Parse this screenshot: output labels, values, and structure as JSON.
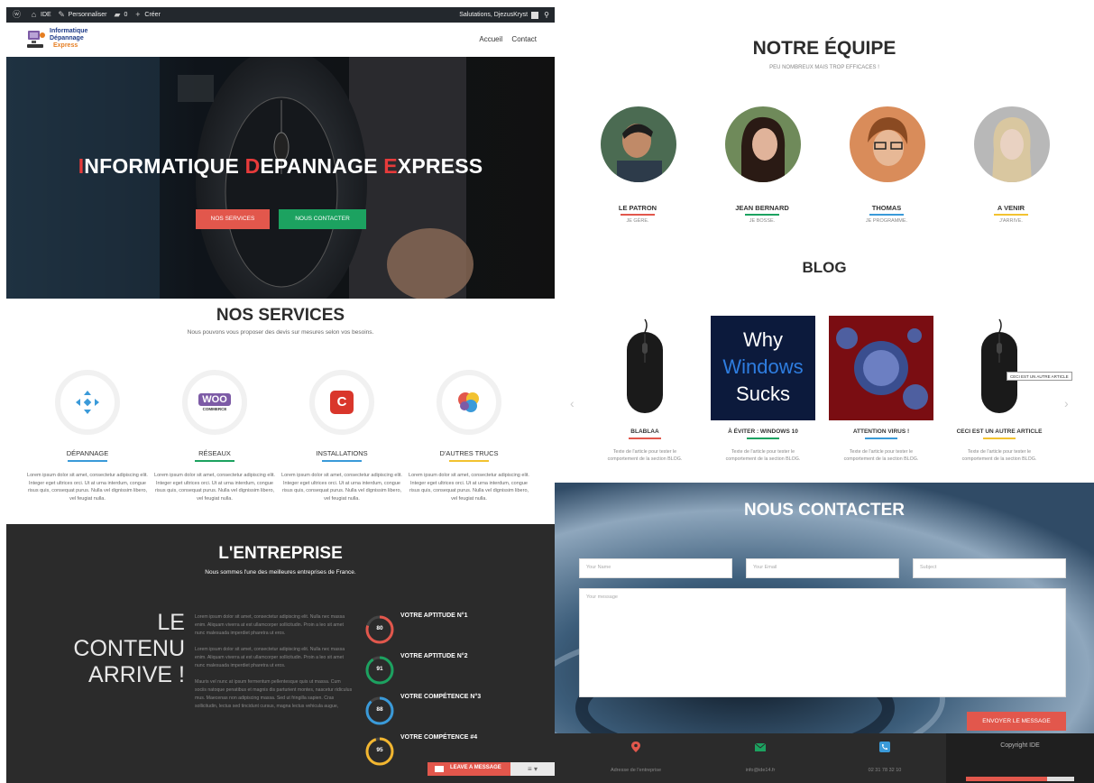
{
  "admin_bar": {
    "site_name": "IDE",
    "customize": "Personnaliser",
    "comments_count": "0",
    "new_label": "Créer",
    "greeting": "Salutations, DjezusKryst"
  },
  "site": {
    "logo_line1": "Informatique",
    "logo_line2": "Dépannage",
    "logo_line3": "Express",
    "nav": [
      "Accueil",
      "Contact"
    ]
  },
  "hero": {
    "title_parts": [
      {
        "letter": "I",
        "rest": "NFORMATIQUE "
      },
      {
        "letter": "D",
        "rest": "EPANNAGE "
      },
      {
        "letter": "E",
        "rest": "XPRESS"
      }
    ],
    "btn_services": "NOS SERVICES",
    "btn_contact": "NOUS CONTACTER"
  },
  "services": {
    "title": "NOS SERVICES",
    "subtitle": "Nous pouvons vous proposer des devis sur mesures selon vos besoins.",
    "items": [
      {
        "title": "DÉPANNAGE",
        "color": "#3a9ad9",
        "text": "Lorem ipsum dolor sit amet, consectetur adipiscing elit. Integer eget ultrices orci. Ut at urna interdum, congue risus quis, consequat purus. Nulla vel dignissim libero, vel feugiat nulla."
      },
      {
        "title": "RÉSEAUX",
        "color": "#1ca260",
        "text": "Lorem ipsum dolor sit amet, consectetur adipiscing elit. Integer eget ultrices orci. Ut at urna interdum, congue risus quis, consequat purus. Nulla vel dignissim libero, vel feugiat nulla."
      },
      {
        "title": "INSTALLATIONS",
        "color": "#3a9ad9",
        "text": "Lorem ipsum dolor sit amet, consectetur adipiscing elit. Integer eget ultrices orci. Ut at urna interdum, congue risus quis, consequat purus. Nulla vel dignissim libero, vel feugiat nulla."
      },
      {
        "title": "D'AUTRES TRUCS",
        "color": "#f2c230",
        "text": "Lorem ipsum dolor sit amet, consectetur adipiscing elit. Integer eget ultrices orci. Ut at urna interdum, congue risus quis, consequat purus. Nulla vel dignissim libero, vel feugiat nulla."
      }
    ],
    "woo_label": "WOO",
    "woo_sub": "COMMERCE",
    "c_label": "C"
  },
  "entreprise": {
    "title": "L'ENTREPRISE",
    "subtitle": "Nous sommes l'une des meilleures entreprises de France.",
    "big_line1": "LE",
    "big_line2": "CONTENU",
    "big_line3": "ARRIVE !",
    "paragraphs": [
      "Lorem ipsum dolor sit amet, consectetur adipiscing elit. Nulla nec massa enim. Aliquam viverra at est ullamcorper sollicitudin. Proin a leo sit amet nunc malesuada imperdiet pharetra ut eros.",
      "Lorem ipsum dolor sit amet, consectetur adipiscing elit. Nulla nec massa enim. Aliquam viverra at est ullamcorper sollicitudin. Proin a leo sit amet nunc malesuada imperdiet pharetra ut eros.",
      "Mauris vel nunc at ipsum fermentum pellentesque quis ut massa. Cum sociis natoque penatibus et magnis dis parturient montes, nascetur ridiculus mus. Maecenas non adipiscing massa. Sed ut fringilla sapien. Cras sollicitudin, lectus sed tincidunt cursus, magna lectus vehicula augue,"
    ],
    "skills": [
      {
        "name": "VOTRE APTITUDE N°1",
        "value": 80,
        "color": "#e2574c"
      },
      {
        "name": "VOTRE APTITUDE N°2",
        "value": 91,
        "color": "#1ca260"
      },
      {
        "name": "VOTRE COMPÉTENCE N°3",
        "value": 88,
        "color": "#3a9ad9"
      },
      {
        "name": "VOTRE COMPÉTENCE #4",
        "value": 95,
        "color": "#f2b630"
      }
    ]
  },
  "chat_widget": {
    "label": "LEAVE A MESSAGE"
  },
  "team": {
    "title": "NOTRE ÉQUIPE",
    "subtitle": "PEU NOMBREUX MAIS TROP EFFICACES !",
    "members": [
      {
        "name": "LE PATRON",
        "role": "JE GÈRE.",
        "color": "#e2574c"
      },
      {
        "name": "JEAN BERNARD",
        "role": "JE BOSSE.",
        "color": "#1ca260"
      },
      {
        "name": "THOMAS",
        "role": "JE PROGRAMME.",
        "color": "#3a9ad9"
      },
      {
        "name": "A VENIR",
        "role": "J'ARRIVE.",
        "color": "#f2c230"
      }
    ]
  },
  "blog": {
    "title": "BLOG",
    "windows_line1": "Why",
    "windows_line2": "Windows",
    "windows_line3": "Sucks",
    "tooltip": "CECI EST UN AUTRE ARTICLE",
    "posts": [
      {
        "title": "BLABLAA",
        "text": "Texte de l'article pour tester le comportement de la section BLOG.",
        "color": "#e2574c"
      },
      {
        "title": "À ÉVITER : WINDOWS 10",
        "text": "Texte de l'article pour tester le comportement de la section BLOG.",
        "color": "#1ca260"
      },
      {
        "title": "ATTENTION VIRUS !",
        "text": "Texte de l'article pour tester le comportement de la section BLOG.",
        "color": "#3a9ad9"
      },
      {
        "title": "CECI EST UN AUTRE ARTICLE",
        "text": "Texte de l'article pour tester le comportement de la section BLOG.",
        "color": "#f2c230"
      }
    ]
  },
  "contact": {
    "title": "NOUS CONTACTER",
    "name_placeholder": "Your Name",
    "email_placeholder": "Your Email",
    "subject_placeholder": "Subject",
    "message_placeholder": "Your message",
    "send_label": "ENVOYER LE MESSAGE"
  },
  "footer": {
    "address": "Adresse de l'entreprise",
    "email": "info@ide14.fr",
    "phone": "02 31 78 32 10",
    "copyright": "Copyright IDE"
  }
}
